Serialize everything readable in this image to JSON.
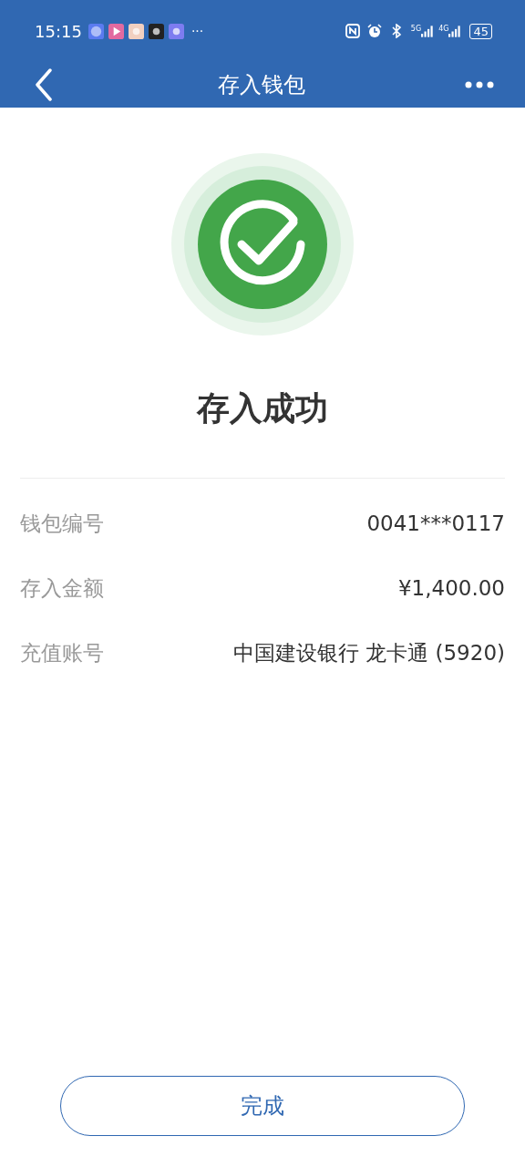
{
  "status_bar": {
    "time": "15:15",
    "more": "···",
    "signal_labels": [
      "5G",
      "4G"
    ],
    "battery": "45"
  },
  "nav": {
    "title": "存入钱包"
  },
  "result": {
    "success": true,
    "title": "存入成功"
  },
  "details": [
    {
      "label": "钱包编号",
      "value": "0041***0117"
    },
    {
      "label": "存入金额",
      "value": "¥1,400.00"
    },
    {
      "label": "充值账号",
      "value": "中国建设银行 龙卡通 (5920)"
    }
  ],
  "button": {
    "label": "完成"
  }
}
